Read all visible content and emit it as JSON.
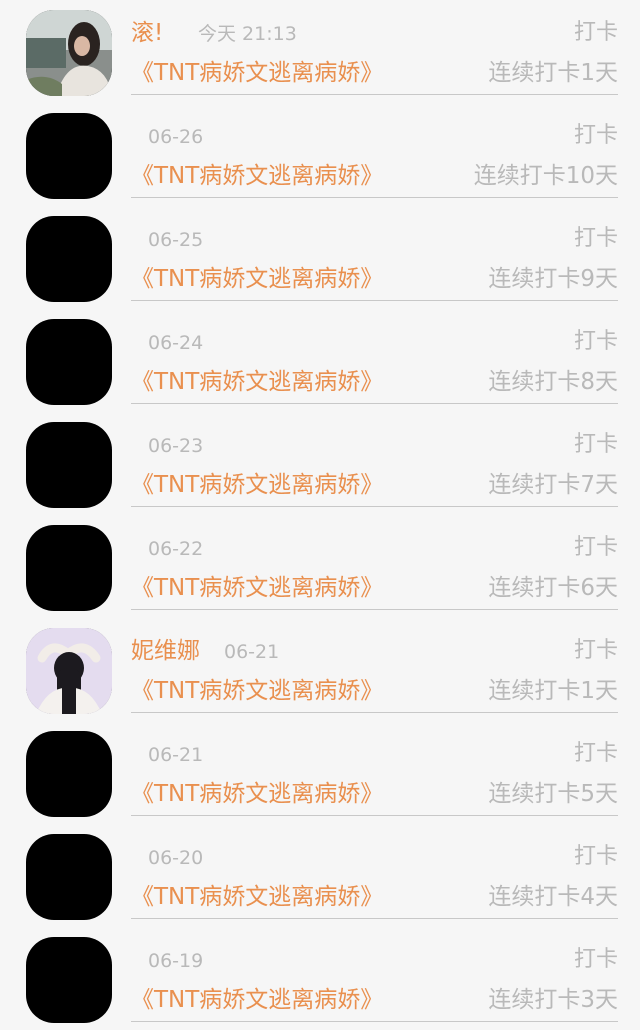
{
  "colors": {
    "accent": "#e9904f",
    "muted_text": "#b9b9b9",
    "divider": "#c8c8c8",
    "background": "#f6f6f6"
  },
  "entries": [
    {
      "avatar": "user-photo-avatar-1",
      "name": "滚!",
      "time": "今天 21:13",
      "action": "打卡",
      "book": "《TNT病娇文逃离病娇》",
      "streak": "连续打卡1天"
    },
    {
      "avatar": "placeholder-avatar",
      "name": "",
      "time": "06-26",
      "action": "打卡",
      "book": "《TNT病娇文逃离病娇》",
      "streak": "连续打卡10天"
    },
    {
      "avatar": "placeholder-avatar",
      "name": "",
      "time": "06-25",
      "action": "打卡",
      "book": "《TNT病娇文逃离病娇》",
      "streak": "连续打卡9天"
    },
    {
      "avatar": "placeholder-avatar",
      "name": "",
      "time": "06-24",
      "action": "打卡",
      "book": "《TNT病娇文逃离病娇》",
      "streak": "连续打卡8天"
    },
    {
      "avatar": "placeholder-avatar",
      "name": "",
      "time": "06-23",
      "action": "打卡",
      "book": "《TNT病娇文逃离病娇》",
      "streak": "连续打卡7天"
    },
    {
      "avatar": "placeholder-avatar",
      "name": "",
      "time": "06-22",
      "action": "打卡",
      "book": "《TNT病娇文逃离病娇》",
      "streak": "连续打卡6天"
    },
    {
      "avatar": "user-photo-avatar-2",
      "name": "妮维娜",
      "time": "06-21",
      "action": "打卡",
      "book": "《TNT病娇文逃离病娇》",
      "streak": "连续打卡1天"
    },
    {
      "avatar": "placeholder-avatar",
      "name": "",
      "time": "06-21",
      "action": "打卡",
      "book": "《TNT病娇文逃离病娇》",
      "streak": "连续打卡5天"
    },
    {
      "avatar": "placeholder-avatar",
      "name": "",
      "time": "06-20",
      "action": "打卡",
      "book": "《TNT病娇文逃离病娇》",
      "streak": "连续打卡4天"
    },
    {
      "avatar": "placeholder-avatar",
      "name": "",
      "time": "06-19",
      "action": "打卡",
      "book": "《TNT病娇文逃离病娇》",
      "streak": "连续打卡3天"
    }
  ]
}
